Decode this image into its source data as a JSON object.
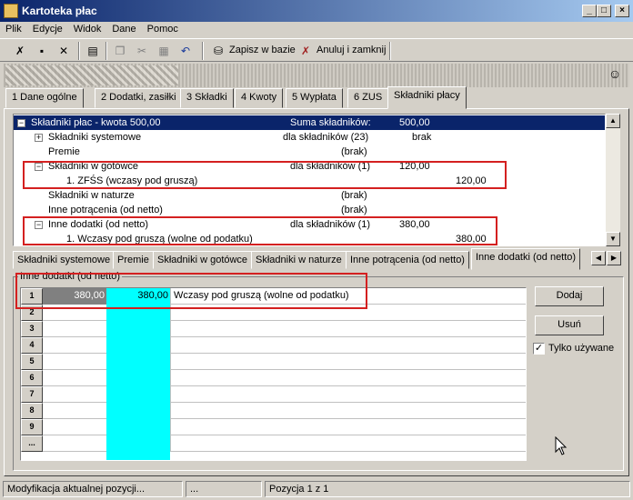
{
  "window": {
    "title": "Kartoteka płac"
  },
  "menu": [
    "Plik",
    "Edycje",
    "Widok",
    "Dane",
    "Pomoc"
  ],
  "toolbar": {
    "save_label": "Zapisz w bazie",
    "cancel_label": "Anuluj i zamknij"
  },
  "tabs": [
    "1 Dane ogólne",
    "2 Dodatki, zasiłki",
    "3 Składki",
    "4 Kwoty",
    "5 Wypłata",
    "6 ZUS",
    "Składniki płacy"
  ],
  "tree": {
    "rows": [
      {
        "pm": "−",
        "name": "Składniki płac - kwota 500,00",
        "info": "Suma składników:",
        "amt": "500,00",
        "amt2": ""
      },
      {
        "pm": "+",
        "name": "Składniki systemowe",
        "info": "dla składników (23)",
        "amt": "brak",
        "amt2": ""
      },
      {
        "pm": "",
        "name": "Premie",
        "info": "(brak)",
        "amt": "",
        "amt2": ""
      },
      {
        "pm": "−",
        "name": "Składniki w gotówce",
        "info": "dla składników (1)",
        "amt": "120,00",
        "amt2": ""
      },
      {
        "pm": "",
        "name": "1.   ZFŚS (wczasy pod gruszą)",
        "info": "",
        "amt": "",
        "amt2": "120,00"
      },
      {
        "pm": "",
        "name": "Składniki w naturze",
        "info": "(brak)",
        "amt": "",
        "amt2": ""
      },
      {
        "pm": "",
        "name": "Inne potrącenia (od netto)",
        "info": "(brak)",
        "amt": "",
        "amt2": ""
      },
      {
        "pm": "−",
        "name": "Inne dodatki (od netto)",
        "info": "dla składników (1)",
        "amt": "380,00",
        "amt2": ""
      },
      {
        "pm": "",
        "name": "1.   Wczasy pod gruszą (wolne od podatku)",
        "info": "",
        "amt": "",
        "amt2": "380,00"
      }
    ]
  },
  "subtabs": [
    "Składniki systemowe",
    "Premie",
    "Składniki w gotówce",
    "Składniki w naturze",
    "Inne potrącenia (od netto)",
    "Inne dodatki (od netto)"
  ],
  "group": {
    "label": "Inne dodatki (od netto)"
  },
  "grid": {
    "rows": [
      {
        "n": "1",
        "a": "380,00",
        "b": "380,00",
        "desc": "Wczasy pod gruszą (wolne od podatku)"
      },
      {
        "n": "2",
        "a": "",
        "b": "",
        "desc": ""
      },
      {
        "n": "3",
        "a": "",
        "b": "",
        "desc": ""
      },
      {
        "n": "4",
        "a": "",
        "b": "",
        "desc": ""
      },
      {
        "n": "5",
        "a": "",
        "b": "",
        "desc": ""
      },
      {
        "n": "6",
        "a": "",
        "b": "",
        "desc": ""
      },
      {
        "n": "7",
        "a": "",
        "b": "",
        "desc": ""
      },
      {
        "n": "8",
        "a": "",
        "b": "",
        "desc": ""
      },
      {
        "n": "9",
        "a": "",
        "b": "",
        "desc": ""
      },
      {
        "n": "...",
        "a": "",
        "b": "",
        "desc": ""
      }
    ]
  },
  "buttons": {
    "add": "Dodaj",
    "remove": "Usuń",
    "only_used": "Tylko używane",
    "only_used_checked": true
  },
  "status": {
    "left": "Modyfikacja aktualnej pozycji...",
    "mid": "...",
    "right": "Pozycja 1 z 1"
  },
  "colors": {
    "title_start": "#0a246a",
    "title_end": "#a6caf0",
    "selection": "#0a246a",
    "highlight_column": "#00ffff",
    "annotation": "#d42020"
  }
}
